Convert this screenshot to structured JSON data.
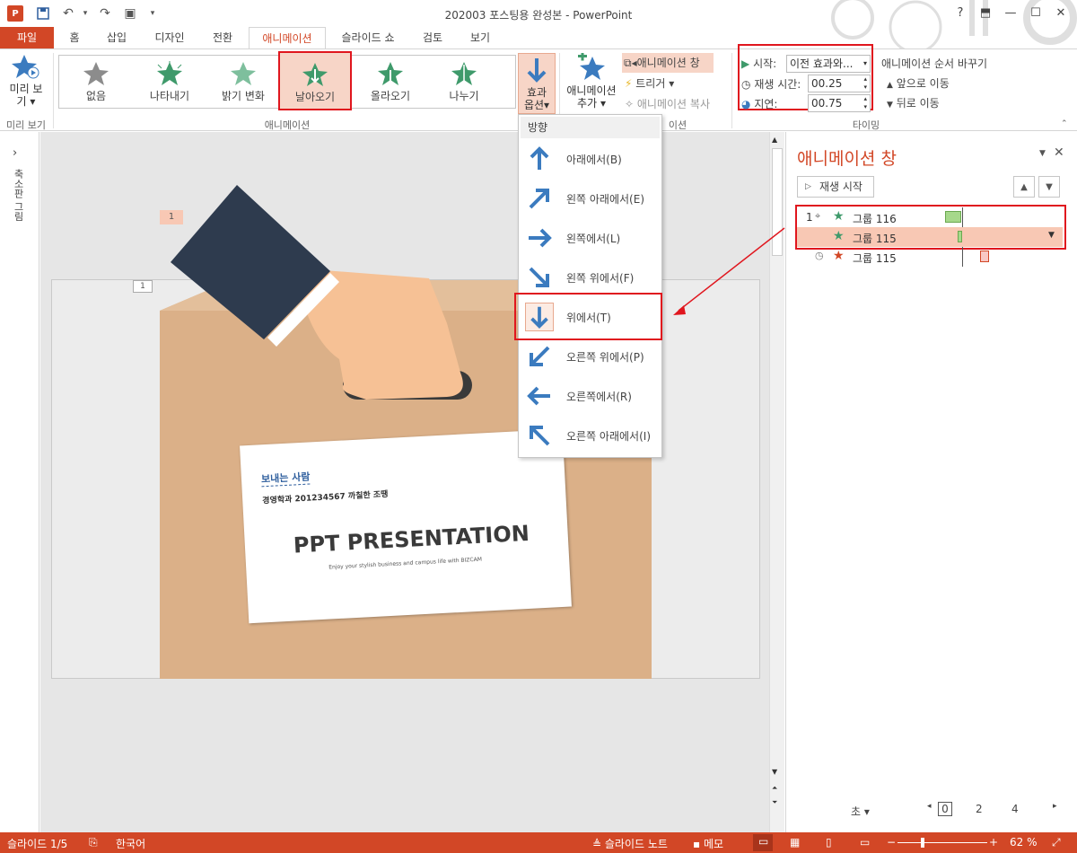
{
  "window": {
    "title": "202003 포스팅용 완성본 - PowerPoint",
    "app_icon_label": "P",
    "help": "?",
    "restore_ribbon_icon": "ribbon-display-icon",
    "minimize": "—",
    "maximize": "☐",
    "close": "✕"
  },
  "tabs": [
    {
      "label": "파일"
    },
    {
      "label": "홈"
    },
    {
      "label": "삽입"
    },
    {
      "label": "디자인"
    },
    {
      "label": "전환"
    },
    {
      "label": "애니메이션"
    },
    {
      "label": "슬라이드 쇼"
    },
    {
      "label": "검토"
    },
    {
      "label": "보기"
    }
  ],
  "ribbon": {
    "preview": {
      "label_line1": "미리 보",
      "label_line2": "기",
      "group": "미리 보기"
    },
    "animations": {
      "group": "애니메이션",
      "items": [
        {
          "label": "없음",
          "color": "#8c8c8c"
        },
        {
          "label": "나타내기",
          "color": "#3f9a6b"
        },
        {
          "label": "밝기 변화",
          "color": "#7ebf9d"
        },
        {
          "label": "날아오기",
          "color": "#3f9a6b"
        },
        {
          "label": "올라오기",
          "color": "#3f9a6b"
        },
        {
          "label": "나누기",
          "color": "#3f9a6b"
        }
      ]
    },
    "effect_options": {
      "line1": "효과",
      "line2": "옵션"
    },
    "add_animation": {
      "line1": "애니메이션",
      "line2": "추가"
    },
    "advanced": {
      "group_partial": "이션",
      "pane": "애니메이션 창",
      "trigger": "트리거",
      "painter": "애니메이션 복사"
    },
    "timing": {
      "group": "타이밍",
      "start_label": "시작:",
      "start_value": "이전 효과와...",
      "duration_label": "재생 시간:",
      "duration_value": "00.25",
      "delay_label": "지연:",
      "delay_value": "00.75",
      "reorder_title": "애니메이션 순서 바꾸기",
      "move_earlier": "앞으로 이동",
      "move_later": "뒤로 이동"
    }
  },
  "dropdown": {
    "header": "방향",
    "items": [
      {
        "label": "아래에서(B)",
        "icon": "arrow-up-icon"
      },
      {
        "label": "왼쪽 아래에서(E)",
        "icon": "arrow-up-right-icon"
      },
      {
        "label": "왼쪽에서(L)",
        "icon": "arrow-right-icon"
      },
      {
        "label": "왼쪽 위에서(F)",
        "icon": "arrow-down-right-icon"
      },
      {
        "label": "위에서(T)",
        "icon": "arrow-down-icon",
        "selected": true
      },
      {
        "label": "오른쪽 위에서(P)",
        "icon": "arrow-down-left-icon"
      },
      {
        "label": "오른쪽에서(R)",
        "icon": "arrow-left-icon"
      },
      {
        "label": "오른쪽 아래에서(I)",
        "icon": "arrow-up-left-icon"
      }
    ]
  },
  "thumbnails_pane": {
    "label": "축소판 그림",
    "expand": "›"
  },
  "slide": {
    "number_badge": "1",
    "tag_badge": "1",
    "card_sender": "보내는 사람",
    "card_info": "경영학과 201234567 까칠한 조땡",
    "card_title": "PPT PRESENTATION",
    "card_subtitle": "Enjoy your stylish business and campus life with BIZCAM"
  },
  "animation_pane": {
    "title": "애니메이션 창",
    "play": "재생 시작",
    "rows": [
      {
        "index": "1",
        "name": "그룹 116"
      },
      {
        "index": "",
        "name": "그룹 115"
      },
      {
        "index": "",
        "name": "그룹 115"
      }
    ],
    "units": "초",
    "ruler": [
      "0",
      "2",
      "4"
    ]
  },
  "statusbar": {
    "slide": "슬라이드 1/5",
    "language": "한국어",
    "notes": "슬라이드 노트",
    "comments": "메모",
    "zoom": "62 %"
  },
  "colors": {
    "accent": "#d24726",
    "highlight_red": "#e0161e",
    "arrow_blue": "#3b7bbf",
    "box": "#dbb088"
  }
}
